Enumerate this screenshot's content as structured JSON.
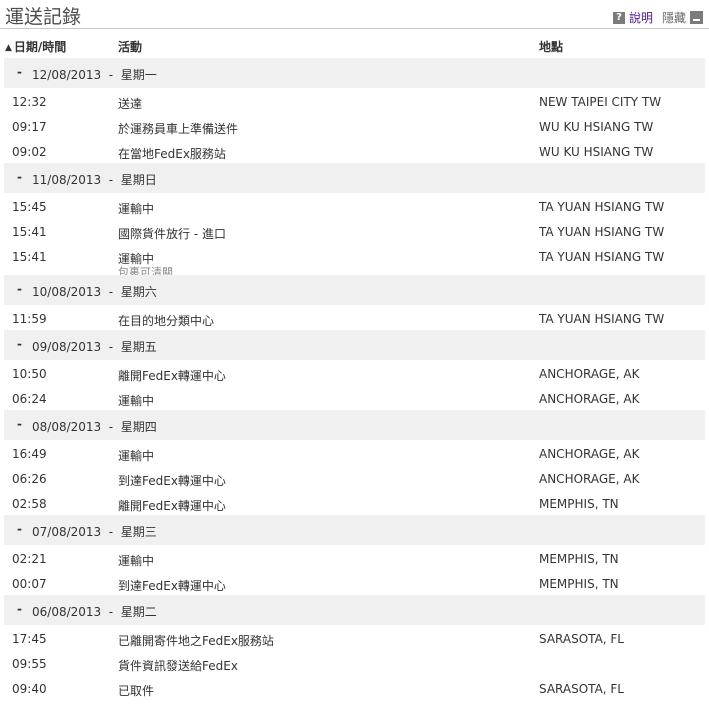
{
  "header": {
    "title": "運送記錄",
    "help_label": "說明",
    "hide_label": "隱藏",
    "help_icon": "?"
  },
  "columns": {
    "date_time": "日期/時間",
    "activity": "活動",
    "location": "地點"
  },
  "groups": [
    {
      "date": "12/08/2013",
      "weekday": "星期一",
      "events": [
        {
          "time": "12:32",
          "activity": "送達",
          "location": "NEW TAIPEI CITY TW"
        },
        {
          "time": "09:17",
          "activity": "於運務員車上準備送件",
          "location": "WU KU HSIANG TW"
        },
        {
          "time": "09:02",
          "activity": "在當地FedEx服務站",
          "location": "WU KU HSIANG TW"
        }
      ]
    },
    {
      "date": "11/08/2013",
      "weekday": "星期日",
      "events": [
        {
          "time": "15:45",
          "activity": "運輸中",
          "location": "TA YUAN HSIANG TW"
        },
        {
          "time": "15:41",
          "activity": "國際貨件放行 - 進口",
          "location": "TA YUAN HSIANG TW"
        },
        {
          "time": "15:41",
          "activity": "運輸中",
          "sub": "包裹可清關",
          "location": "TA YUAN HSIANG TW"
        }
      ]
    },
    {
      "date": "10/08/2013",
      "weekday": "星期六",
      "events": [
        {
          "time": "11:59",
          "activity": "在目的地分類中心",
          "location": "TA YUAN HSIANG TW"
        }
      ]
    },
    {
      "date": "09/08/2013",
      "weekday": "星期五",
      "events": [
        {
          "time": "10:50",
          "activity": "離開FedEx轉運中心",
          "location": "ANCHORAGE, AK"
        },
        {
          "time": "06:24",
          "activity": "運輸中",
          "location": "ANCHORAGE, AK"
        }
      ]
    },
    {
      "date": "08/08/2013",
      "weekday": "星期四",
      "events": [
        {
          "time": "16:49",
          "activity": "運輸中",
          "location": "ANCHORAGE, AK"
        },
        {
          "time": "06:26",
          "activity": "到達FedEx轉運中心",
          "location": "ANCHORAGE, AK"
        },
        {
          "time": "02:58",
          "activity": "離開FedEx轉運中心",
          "location": "MEMPHIS, TN"
        }
      ]
    },
    {
      "date": "07/08/2013",
      "weekday": "星期三",
      "events": [
        {
          "time": "02:21",
          "activity": "運輸中",
          "location": "MEMPHIS, TN"
        },
        {
          "time": "00:07",
          "activity": "到達FedEx轉運中心",
          "location": "MEMPHIS, TN"
        }
      ]
    },
    {
      "date": "06/08/2013",
      "weekday": "星期二",
      "events": [
        {
          "time": "17:45",
          "activity": "已離開寄件地之FedEx服務站",
          "location": "SARASOTA, FL"
        },
        {
          "time": "09:55",
          "activity": "貨件資訊發送給FedEx",
          "location": ""
        },
        {
          "time": "09:40",
          "activity": "已取件",
          "location": "SARASOTA, FL"
        }
      ]
    }
  ]
}
